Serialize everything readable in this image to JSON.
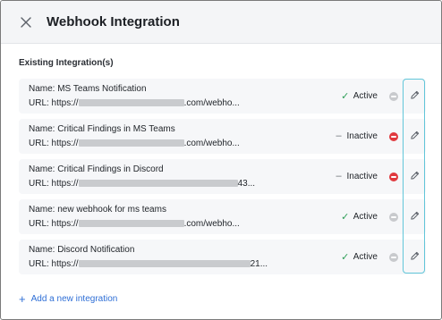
{
  "header": {
    "title": "Webhook Integration",
    "close_icon": "close-icon"
  },
  "section_label": "Existing Integration(s)",
  "integrations": [
    {
      "name": "Name: MS Teams Notification",
      "url_prefix": "URL: https://",
      "url_suffix": ".com/webho...",
      "status": "Active",
      "active": true
    },
    {
      "name": "Name: Critical Findings in MS Teams",
      "url_prefix": "URL: https://",
      "url_suffix": ".com/webho...",
      "status": "Inactive",
      "active": false
    },
    {
      "name": "Name: Critical Findings in Discord",
      "url_prefix": "URL: https://",
      "url_suffix": "43...",
      "status": "Inactive",
      "active": false
    },
    {
      "name": "Name: new webhook for ms teams",
      "url_prefix": "URL: https://",
      "url_suffix": ".com/webho...",
      "status": "Active",
      "active": true
    },
    {
      "name": "Name: Discord Notification",
      "url_prefix": "URL: https://",
      "url_suffix": "21...",
      "status": "Active",
      "active": true
    }
  ],
  "add_link": "Add a new integration",
  "colors": {
    "active_check": "#2e9e57",
    "inactive_dash": "#6b6f75",
    "toggle_active": "#c8cacd",
    "toggle_inactive": "#e0393e",
    "edit_highlight": "#62c6d9",
    "link": "#2f6fd6"
  }
}
